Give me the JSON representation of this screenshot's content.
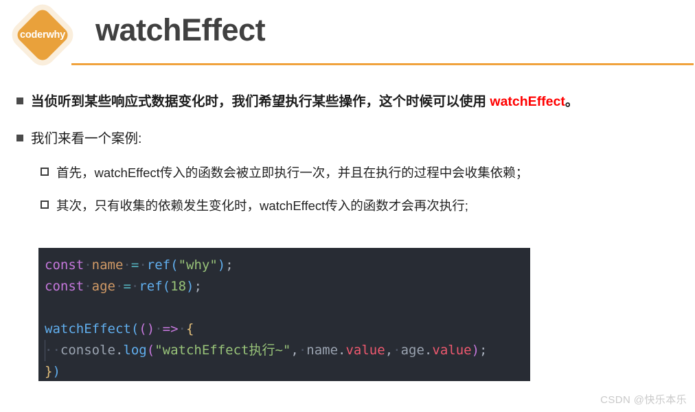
{
  "header": {
    "logo_text": "coderwhy",
    "title": "watchEffect"
  },
  "bullets": [
    {
      "marker": "filled-square",
      "level": 1,
      "bold": true,
      "text_before": "当侦听到某些响应式数据变化时，我们希望执行某些操作，这个时候可以使用 ",
      "highlight": "watchEffect",
      "highlight_color": "#ff0000",
      "text_after": "。"
    },
    {
      "marker": "filled-square",
      "level": 1,
      "bold": false,
      "text": "我们来看一个案例:"
    }
  ],
  "sub_bullets": [
    {
      "marker": "hollow-square",
      "level": 2,
      "text": "首先，watchEffect传入的函数会被立即执行一次，并且在执行的过程中会收集依赖；"
    },
    {
      "marker": "hollow-square",
      "level": 2,
      "text": "其次，只有收集的依赖发生变化时，watchEffect传入的函数才会再次执行;"
    }
  ],
  "code": {
    "background": "#282c34",
    "language": "javascript",
    "lines": [
      {
        "indent_guide": false,
        "tokens": [
          {
            "t": "const",
            "c": "t-kw"
          },
          {
            "t": "·",
            "c": "sp"
          },
          {
            "t": "name",
            "c": "t-var"
          },
          {
            "t": "·",
            "c": "sp"
          },
          {
            "t": "=",
            "c": "t-op"
          },
          {
            "t": "·",
            "c": "sp"
          },
          {
            "t": "ref",
            "c": "t-fn"
          },
          {
            "t": "(",
            "c": "t-paren"
          },
          {
            "t": "\"why\"",
            "c": "t-str"
          },
          {
            "t": ")",
            "c": "t-paren"
          },
          {
            "t": ";",
            "c": "t-punc"
          }
        ]
      },
      {
        "indent_guide": false,
        "tokens": [
          {
            "t": "const",
            "c": "t-kw"
          },
          {
            "t": "·",
            "c": "sp"
          },
          {
            "t": "age",
            "c": "t-var"
          },
          {
            "t": "·",
            "c": "sp"
          },
          {
            "t": "=",
            "c": "t-op"
          },
          {
            "t": "·",
            "c": "sp"
          },
          {
            "t": "ref",
            "c": "t-fn"
          },
          {
            "t": "(",
            "c": "t-paren"
          },
          {
            "t": "18",
            "c": "t-num"
          },
          {
            "t": ")",
            "c": "t-paren"
          },
          {
            "t": ";",
            "c": "t-punc"
          }
        ]
      },
      {
        "indent_guide": false,
        "tokens": []
      },
      {
        "indent_guide": false,
        "tokens": [
          {
            "t": "watchEffect",
            "c": "t-fn"
          },
          {
            "t": "(",
            "c": "t-paren"
          },
          {
            "t": "(",
            "c": "t-paren-m"
          },
          {
            "t": ")",
            "c": "t-paren-m"
          },
          {
            "t": "·",
            "c": "sp"
          },
          {
            "t": "=>",
            "c": "t-arrow"
          },
          {
            "t": "·",
            "c": "sp"
          },
          {
            "t": "{",
            "c": "t-paren-y"
          }
        ]
      },
      {
        "indent_guide": true,
        "tokens": [
          {
            "t": "··",
            "c": "sp"
          },
          {
            "t": "console",
            "c": "t-obj"
          },
          {
            "t": ".",
            "c": "t-punc"
          },
          {
            "t": "log",
            "c": "t-fn"
          },
          {
            "t": "(",
            "c": "t-paren-m"
          },
          {
            "t": "\"watchEffect执行~\"",
            "c": "t-str"
          },
          {
            "t": ",",
            "c": "t-punc"
          },
          {
            "t": "·",
            "c": "sp"
          },
          {
            "t": "name",
            "c": "t-obj"
          },
          {
            "t": ".",
            "c": "t-punc"
          },
          {
            "t": "value",
            "c": "t-prop"
          },
          {
            "t": ",",
            "c": "t-punc"
          },
          {
            "t": "·",
            "c": "sp"
          },
          {
            "t": "age",
            "c": "t-obj"
          },
          {
            "t": ".",
            "c": "t-punc"
          },
          {
            "t": "value",
            "c": "t-prop"
          },
          {
            "t": ")",
            "c": "t-paren-m"
          },
          {
            "t": ";",
            "c": "t-punc"
          }
        ]
      },
      {
        "indent_guide": false,
        "tokens": [
          {
            "t": "}",
            "c": "t-paren-y"
          },
          {
            "t": ")",
            "c": "t-paren"
          }
        ]
      }
    ]
  },
  "watermark": {
    "text": "CSDN @快乐本乐"
  }
}
